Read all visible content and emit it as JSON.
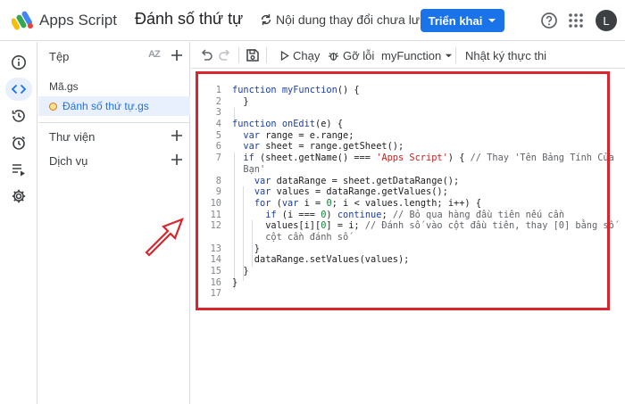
{
  "header": {
    "app_title": "Apps Script",
    "project_title": "Đánh số thứ tự",
    "save_status": "Nội dung thay đổi chưa lưu",
    "deploy_label": "Triển khai",
    "avatar_letter": "L"
  },
  "rail": {
    "items": [
      "info-icon",
      "code-icon",
      "history-icon",
      "clock-icon",
      "executions-icon",
      "settings-icon"
    ],
    "active_index": 1
  },
  "files": {
    "title": "Tệp",
    "sort_label": "AZ",
    "items": [
      {
        "name": "Mã.gs"
      },
      {
        "name": "Đánh số thứ tự.gs",
        "active": true,
        "unsaved": true
      }
    ],
    "sections": [
      "Thư viện",
      "Dịch vụ"
    ]
  },
  "toolbar": {
    "run_label": "Chạy",
    "debug_label": "Gỡ lỗi",
    "function_select": "myFunction",
    "log_label": "Nhật ký thực thi"
  },
  "editor": {
    "line_numbers": [
      "1",
      "2",
      "3",
      "4",
      "5",
      "6",
      "7",
      "",
      "8",
      "9",
      "10",
      "11",
      "12",
      "",
      "13",
      "14",
      "15",
      "16",
      "17"
    ],
    "lines": [
      "function myFunction() {",
      "  }",
      "",
      "function onEdit(e) {",
      "  var range = e.range;",
      "  var sheet = range.getSheet();",
      "  if (sheet.getName() === 'Apps Script') { // Thay 'Tên Bảng Tính Của",
      "  Bạn'",
      "    var dataRange = sheet.getDataRange();",
      "    var values = dataRange.getValues();",
      "    for (var i = 0; i < values.length; i++) {",
      "      if (i === 0) continue; // Bỏ qua hàng đầu tiên nếu cần",
      "      values[i][0] = i; // Đánh số vào cột đầu tiên, thay [0] bằng số",
      "      cột cần đánh số",
      "    }",
      "    dataRange.setValues(values);",
      "  }",
      "}",
      ""
    ]
  },
  "colors": {
    "accent": "#1a73e8",
    "highlight": "#d7262e",
    "keyword": "#1a3ea8",
    "string": "#c5221f",
    "number": "#188038",
    "comment": "#5f6368"
  }
}
